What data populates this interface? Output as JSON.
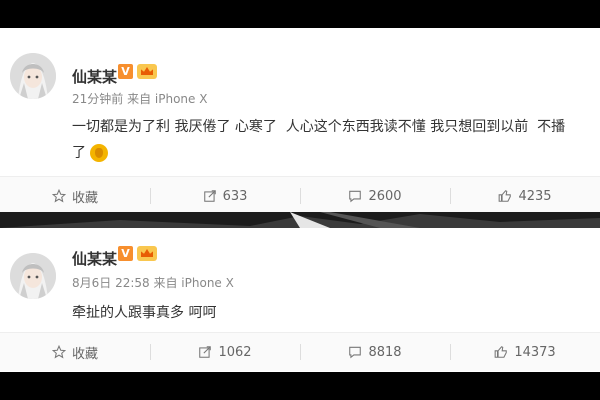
{
  "posts": [
    {
      "user": {
        "name": "仙某某"
      },
      "badges": {
        "vip": "V"
      },
      "meta": "21分钟前 来自 iPhone X",
      "content": "一切都是为了利 我厌倦了 心寒了  人心这个东西我读不懂 我只想回到以前  不播\n了",
      "toolbar": {
        "favorite_label": "收藏",
        "repost_count": "633",
        "comment_count": "2600",
        "like_count": "4235"
      }
    },
    {
      "user": {
        "name": "仙某某"
      },
      "badges": {
        "vip": "V"
      },
      "meta": "8月6日 22:58 来自 iPhone X",
      "content": "牵扯的人跟事真多 呵呵",
      "toolbar": {
        "favorite_label": "收藏",
        "repost_count": "1062",
        "comment_count": "8818",
        "like_count": "14373"
      }
    }
  ],
  "icons": [
    "star-icon",
    "repost-icon",
    "comment-icon",
    "like-icon",
    "clap-emoji-icon",
    "vip-badge-icon",
    "crown-badge-icon"
  ],
  "colors": {
    "text": "#333333",
    "muted": "#888888",
    "toolbar_bg": "#fafafa",
    "vip": "#f78f2e"
  }
}
